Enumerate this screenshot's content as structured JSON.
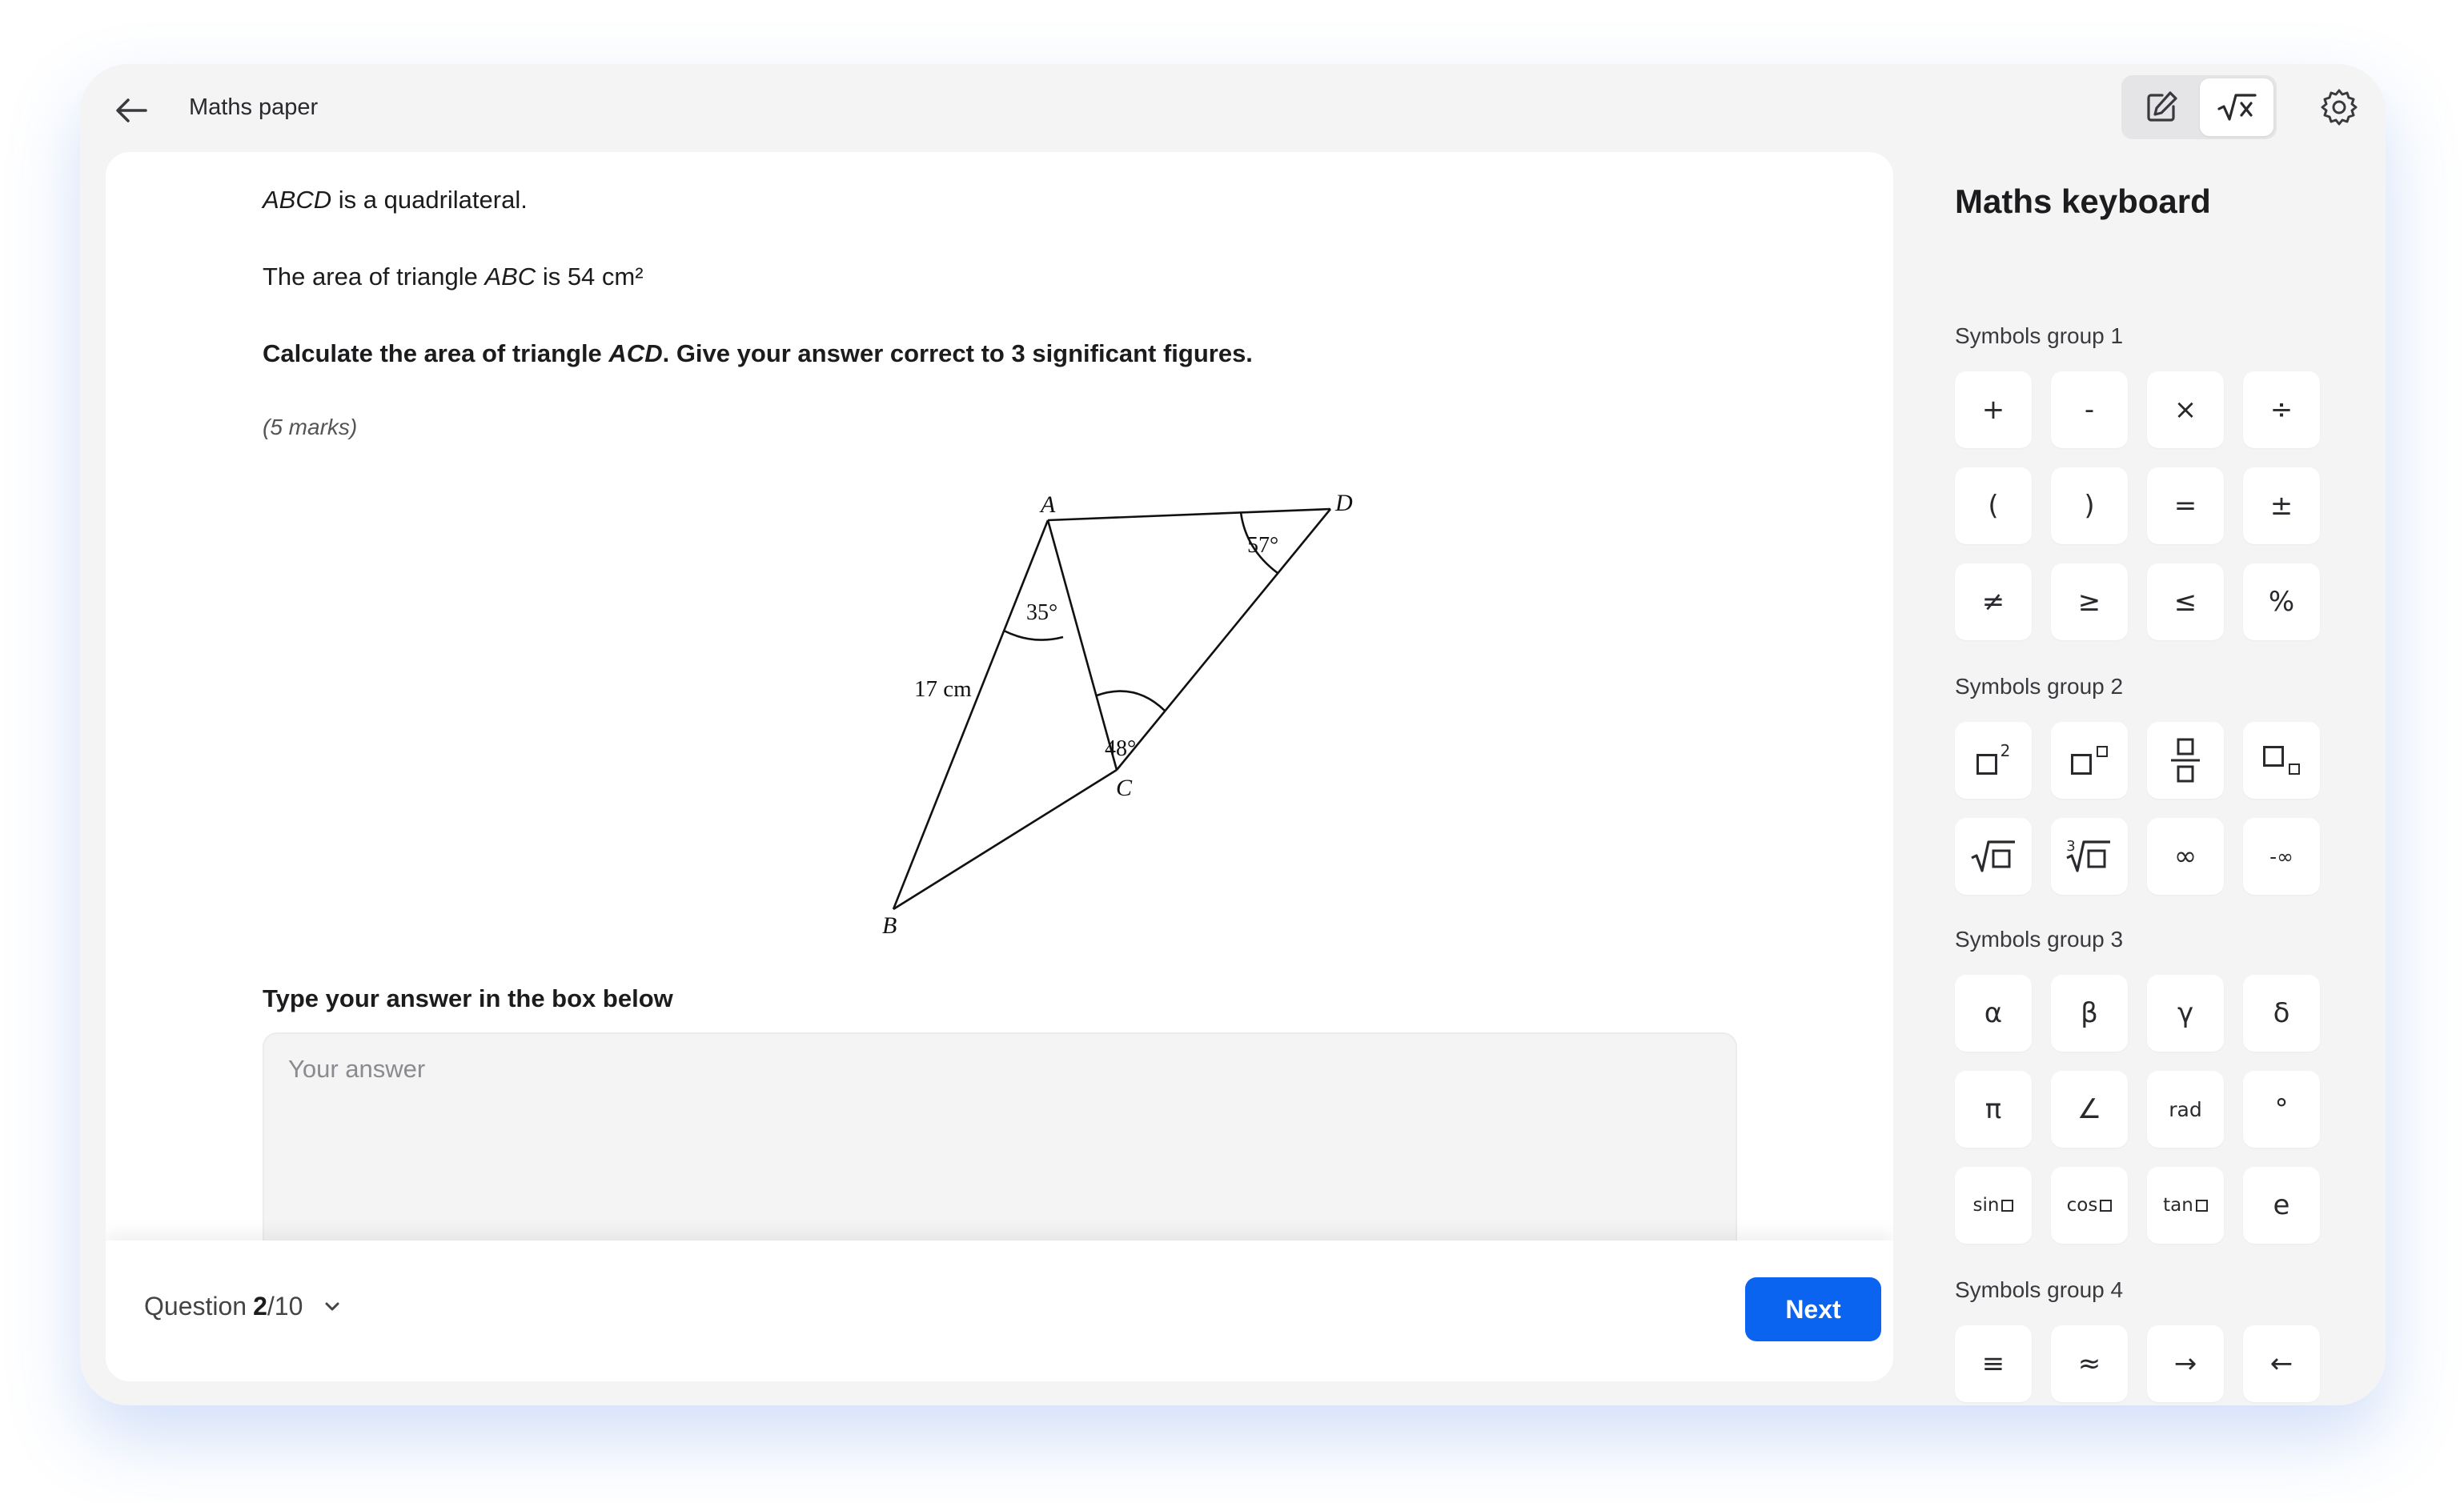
{
  "header": {
    "title": "Maths paper"
  },
  "question": {
    "line1_italic": "ABCD",
    "line1_rest": " is a quadrilateral.",
    "line2_before": "The area of triangle ",
    "line2_italic": "ABC",
    "line2_after": " is 54 cm²",
    "instruction_before": "Calculate the area of triangle ",
    "instruction_italic": "ACD",
    "instruction_after": ". Give your answer correct to 3 significant figures.",
    "marks": "(5 marks)"
  },
  "diagram": {
    "vertex_a": "A",
    "vertex_b": "B",
    "vertex_c": "C",
    "vertex_d": "D",
    "side_ab": "17 cm",
    "angle_bac": "35°",
    "angle_acd": "48°",
    "angle_adc": "57°"
  },
  "answer": {
    "label": "Type your answer in the box below",
    "placeholder": "Your answer"
  },
  "footer": {
    "question_prefix": "Question ",
    "question_current": "2",
    "question_total": "/10",
    "next_label": "Next"
  },
  "keyboard": {
    "title": "Maths keyboard",
    "group1_label": "Symbols group 1",
    "group1": [
      "+",
      "-",
      "×",
      "÷",
      "(",
      ")",
      "=",
      "±",
      "≠",
      "≥",
      "≤",
      "%"
    ],
    "group2_label": "Symbols group 2",
    "group2": {
      "square_sup": "2",
      "cube_root_index": "3",
      "infinity": "∞",
      "neg_infinity": "-∞"
    },
    "group3_label": "Symbols group 3",
    "group3": [
      "α",
      "β",
      "γ",
      "δ",
      "π",
      "∠",
      "rad",
      "°",
      "sin",
      "cos",
      "tan",
      "e"
    ],
    "group4_label": "Symbols group 4",
    "group4": [
      "≡",
      "≈",
      "→",
      "←"
    ]
  }
}
